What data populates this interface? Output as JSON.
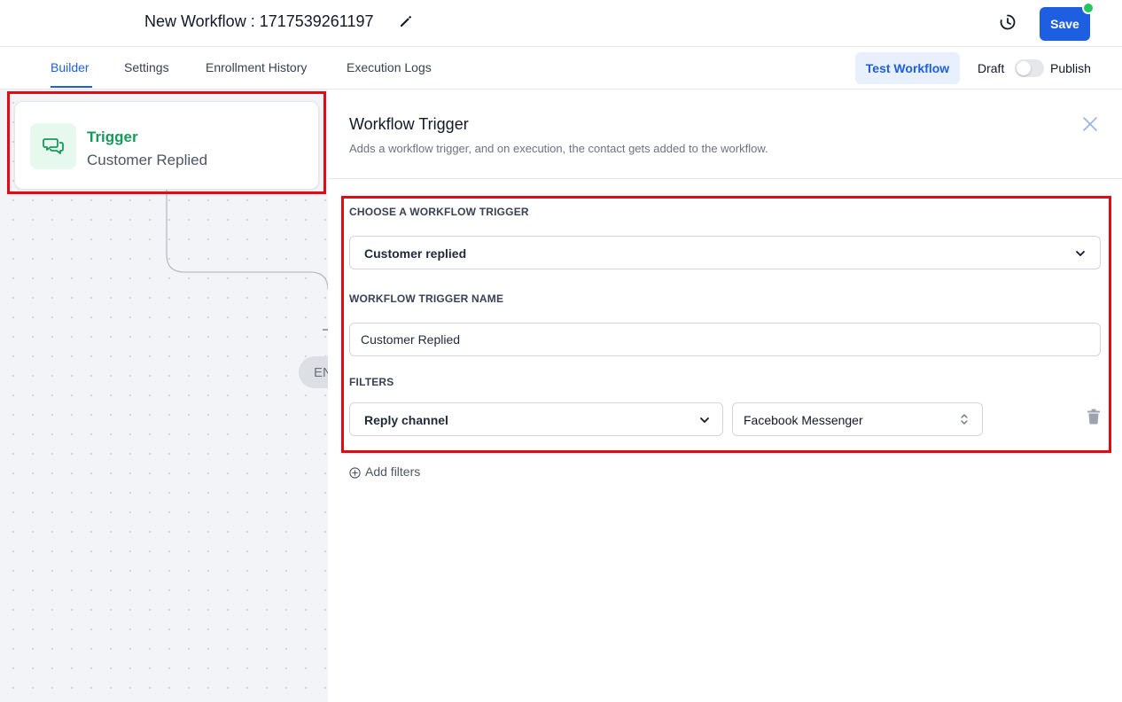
{
  "header": {
    "title": "New Workflow : 1717539261197",
    "save_label": "Save",
    "icons": {
      "edit": "pencil-icon",
      "history": "history-icon"
    },
    "status_color": "#22c55e"
  },
  "tabs": {
    "items": [
      {
        "label": "Builder",
        "active": true
      },
      {
        "label": "Settings",
        "active": false
      },
      {
        "label": "Enrollment History",
        "active": false
      },
      {
        "label": "Execution Logs",
        "active": false
      }
    ],
    "test_label": "Test Workflow",
    "draft_label": "Draft",
    "publish_label": "Publish",
    "publish_on": false
  },
  "canvas": {
    "trigger_title": "Trigger",
    "trigger_subtitle": "Customer Replied",
    "end_label": "EN"
  },
  "panel": {
    "title": "Workflow Trigger",
    "description": "Adds a workflow trigger, and on execution, the contact gets added to the workflow.",
    "choose_label": "CHOOSE A WORKFLOW TRIGGER",
    "trigger_value": "Customer replied",
    "name_label": "WORKFLOW TRIGGER NAME",
    "name_value": "Customer Replied",
    "filters_label": "FILTERS",
    "filter_field": "Reply channel",
    "filter_value": "Facebook Messenger",
    "add_filters": "Add filters"
  },
  "colors": {
    "accent": "#1d5fe0",
    "trigger_green": "#159a5a",
    "highlight_red": "#e50914"
  }
}
